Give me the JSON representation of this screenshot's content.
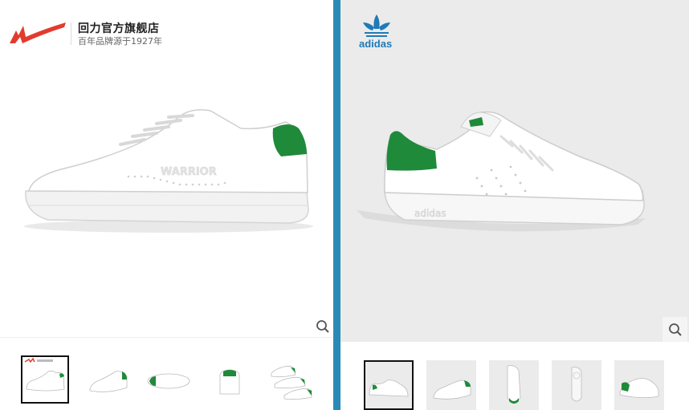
{
  "left_store": {
    "name": "回力官方旗舰店",
    "tagline": "百年品牌源于1927年",
    "logo_icon": "warrior-logo-icon",
    "shoe_brand_mark": "WARRIOR",
    "thumbnail_count": 5,
    "selected_thumbnail": 1,
    "accent_color": "#e23b2e"
  },
  "right_store": {
    "brand": "adidas",
    "logo_icon": "adidas-trefoil-icon",
    "sole_mark": "adidas",
    "thumbnail_count": 5,
    "selected_thumbnail": 1,
    "accent_color": "#1f7ab8"
  },
  "shoe_colors": {
    "heel": "#1f8a3a",
    "upper": "#ffffff"
  },
  "divider_color": "#2a8ab6"
}
